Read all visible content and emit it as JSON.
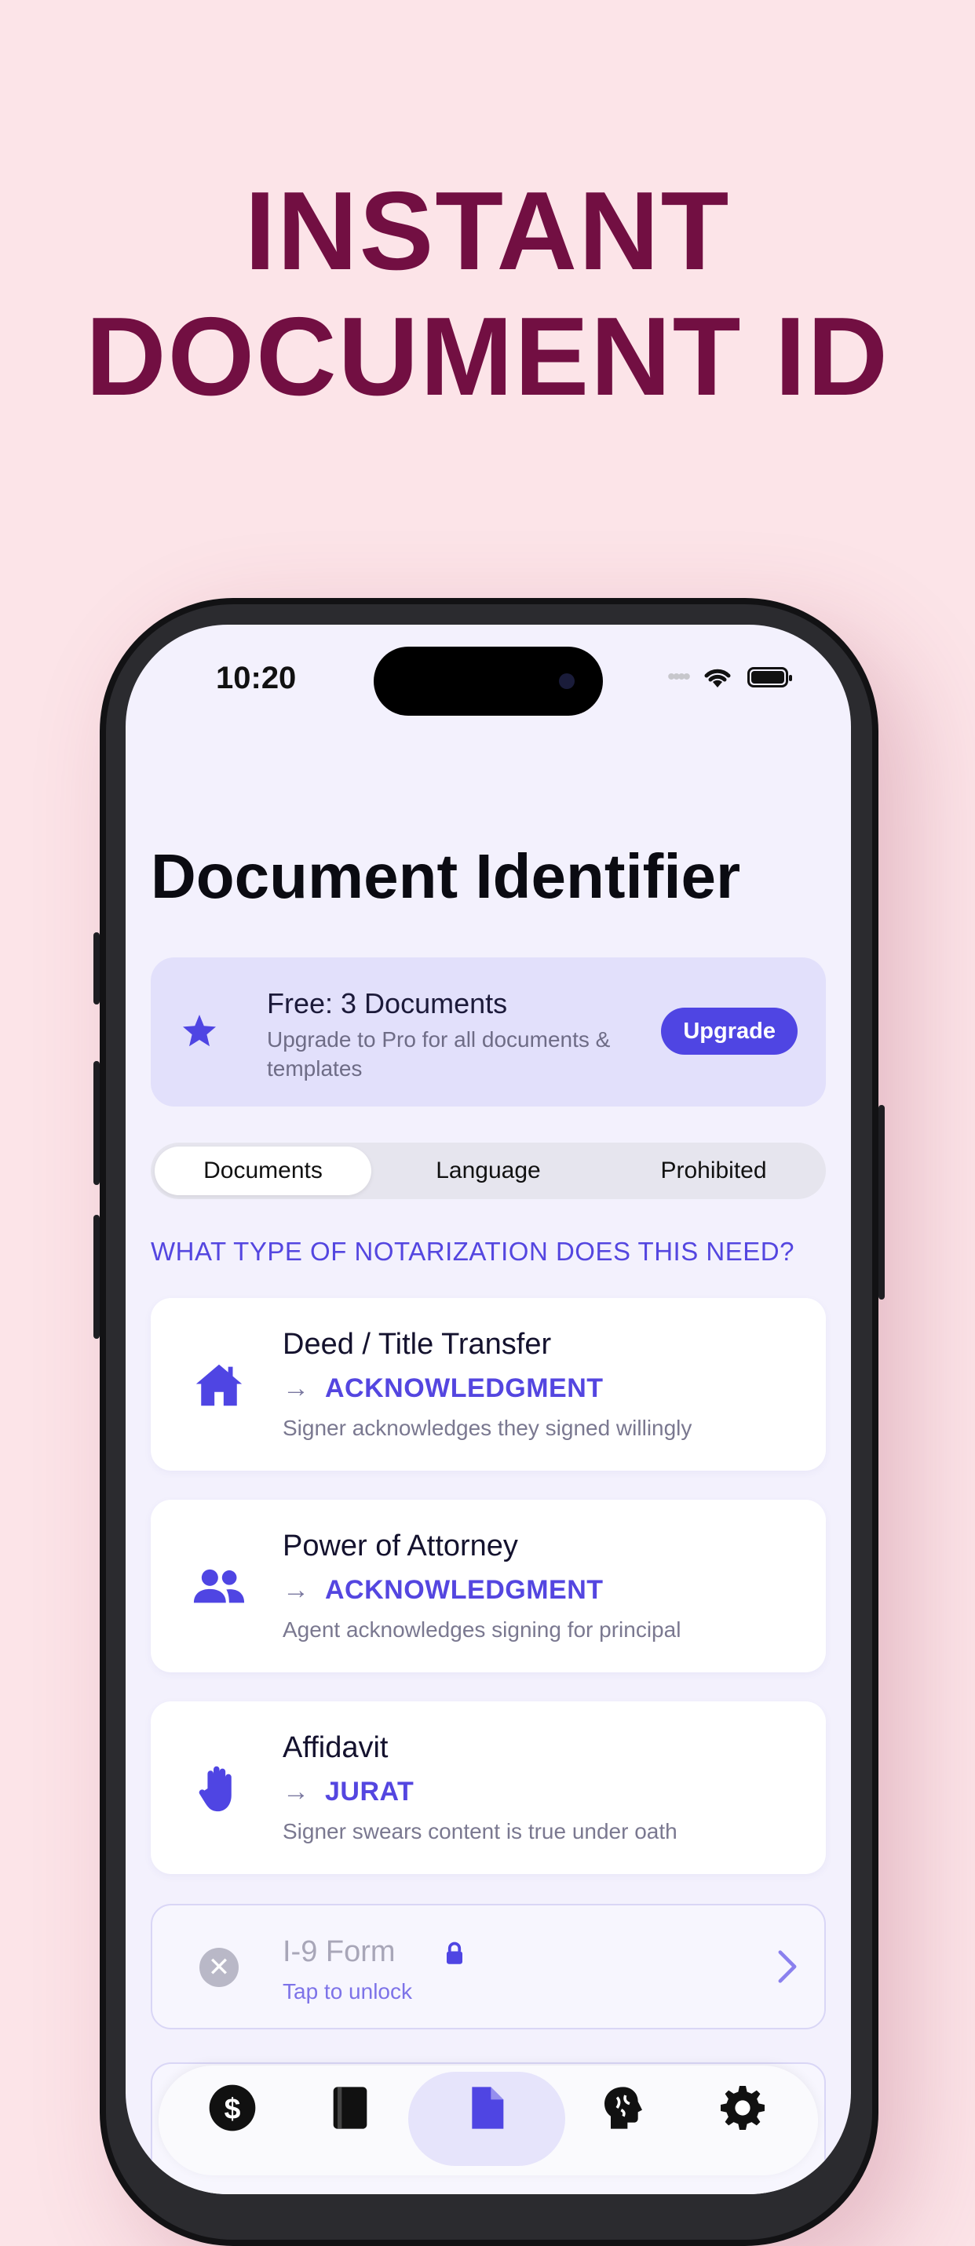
{
  "headline": {
    "line1": "INSTANT",
    "line2": "DOCUMENT ID"
  },
  "status_bar": {
    "time": "10:20"
  },
  "screen": {
    "title": "Document Identifier",
    "promo": {
      "title": "Free: 3 Documents",
      "subtitle": "Upgrade to Pro for all documents & templates",
      "button": "Upgrade"
    },
    "segments": [
      "Documents",
      "Language",
      "Prohibited"
    ],
    "active_segment": "Documents",
    "section_label": "WHAT TYPE OF NOTARIZATION DOES THIS NEED?",
    "cards": [
      {
        "title": "Deed / Title Transfer",
        "arrow": "→",
        "type": "ACKNOWLEDGMENT",
        "description": "Signer acknowledges they signed willingly",
        "icon": "house-icon"
      },
      {
        "title": "Power of Attorney",
        "arrow": "→",
        "type": "ACKNOWLEDGMENT",
        "description": "Agent acknowledges signing for principal",
        "icon": "people-icon"
      },
      {
        "title": "Affidavit",
        "arrow": "→",
        "type": "JURAT",
        "description": "Signer swears content is true under oath",
        "icon": "raised-hand-icon"
      }
    ],
    "locked_card": {
      "title": "I-9 Form",
      "subtitle": "Tap to unlock",
      "icon": "close-circle-icon"
    },
    "tab_bar": {
      "items": [
        "dollar-icon",
        "book-icon",
        "document-icon",
        "brain-icon",
        "gear-icon"
      ],
      "active": "document-icon"
    }
  },
  "colors": {
    "background": "#fce4e8",
    "headline": "#720f42",
    "accent": "#5446e0",
    "button": "#4f45e3"
  }
}
